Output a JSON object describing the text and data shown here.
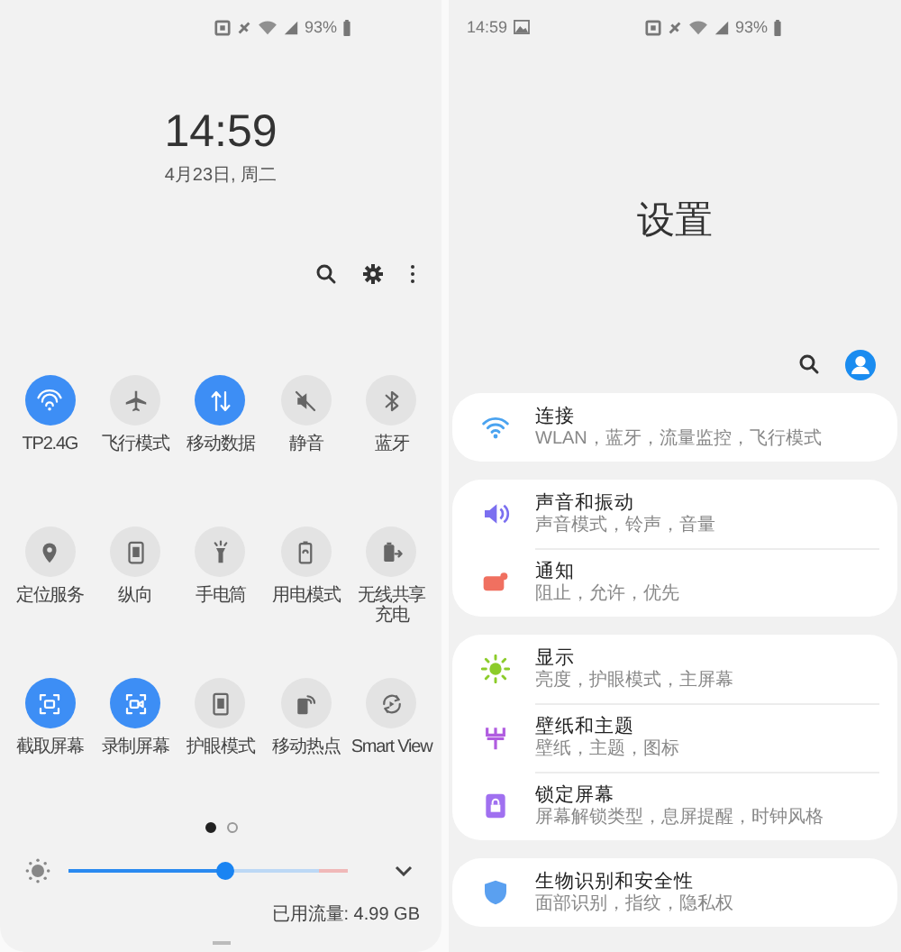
{
  "left": {
    "status_bar": {
      "battery": "93%"
    },
    "clock": {
      "time": "14:59",
      "date": "4月23日, 周二"
    },
    "tiles": [
      {
        "label": "TP2.4G",
        "on": true
      },
      {
        "label": "飞行模式",
        "on": false
      },
      {
        "label": "移动数据",
        "on": true
      },
      {
        "label": "静音",
        "on": false
      },
      {
        "label": "蓝牙",
        "on": false
      },
      {
        "label": "定位服务",
        "on": false
      },
      {
        "label": "纵向",
        "on": false
      },
      {
        "label": "手电筒",
        "on": false
      },
      {
        "label": "用电模式",
        "on": false
      },
      {
        "label": "无线共享充电",
        "on": false
      },
      {
        "label": "截取屏幕",
        "on": true
      },
      {
        "label": "录制屏幕",
        "on": true
      },
      {
        "label": "护眼模式",
        "on": false
      },
      {
        "label": "移动热点",
        "on": false
      },
      {
        "label": "Smart View",
        "on": false
      }
    ],
    "pages": [
      {
        "selected": true
      },
      {
        "selected": false
      }
    ],
    "brightness": {
      "level": 0.56
    },
    "data_usage": "已用流量: 4.99 GB"
  },
  "right": {
    "status_bar": {
      "time": "14:59",
      "battery": "93%"
    },
    "title": "设置",
    "groups": [
      {
        "items": [
          {
            "title": "连接",
            "subtitle": "WLAN，蓝牙，流量监控，飞行模式",
            "color": "#4aa3f0"
          }
        ]
      },
      {
        "items": [
          {
            "title": "声音和振动",
            "subtitle": "声音模式，铃声，音量",
            "color": "#7b6ff0"
          },
          {
            "title": "通知",
            "subtitle": "阻止，允许，优先",
            "color": "#f07060"
          }
        ]
      },
      {
        "items": [
          {
            "title": "显示",
            "subtitle": "亮度，护眼模式，主屏幕",
            "color": "#8ccc2a"
          },
          {
            "title": "壁纸和主题",
            "subtitle": "壁纸，主题，图标",
            "color": "#b05ce0"
          },
          {
            "title": "锁定屏幕",
            "subtitle": "屏幕解锁类型，息屏提醒，时钟风格",
            "color": "#a070f0"
          }
        ]
      },
      {
        "items": [
          {
            "title": "生物识别和安全性",
            "subtitle": "面部识别，指纹，隐私权",
            "color": "#5aa0f0"
          }
        ]
      }
    ]
  }
}
